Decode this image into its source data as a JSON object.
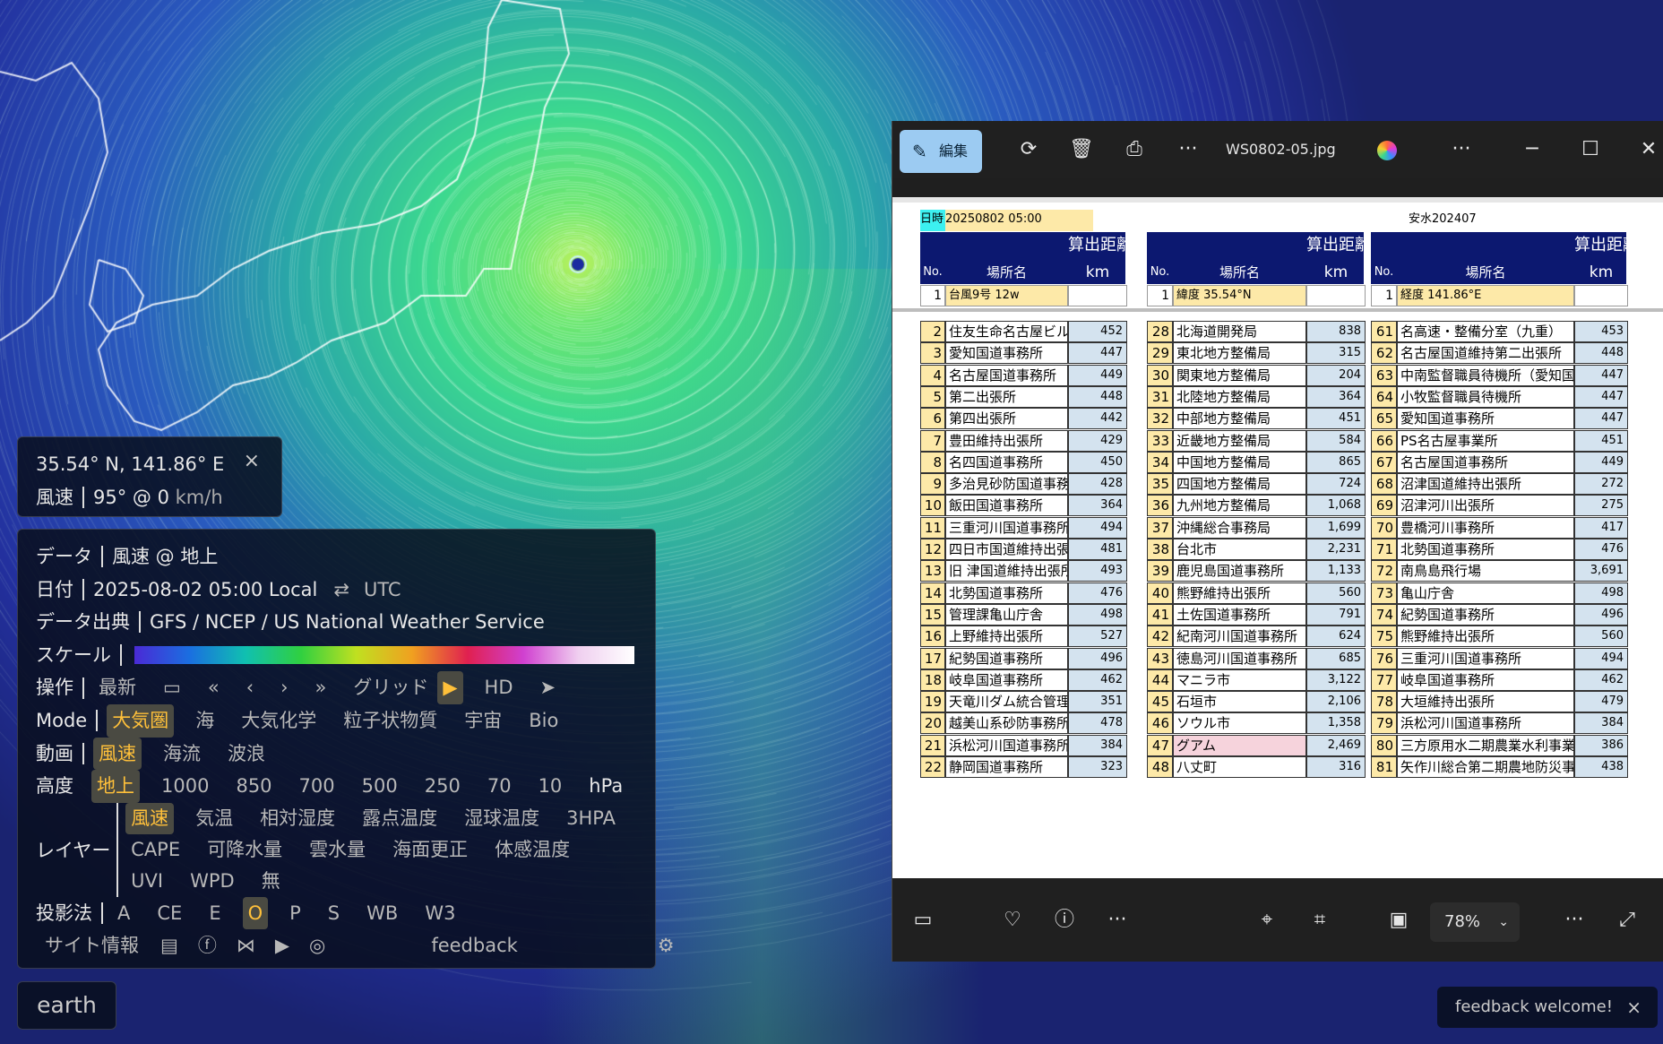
{
  "earth": {
    "coordinates": "35.54° N, 141.86° E",
    "close_icon": "×",
    "wind_label": "風速",
    "wind_value": "95° @ 0",
    "wind_unit": "km/h",
    "rows": {
      "data": {
        "label": "データ",
        "value": "風速 @ 地上"
      },
      "date": {
        "label": "日付",
        "value": "2025-08-02 05:00 Local",
        "swap": "⇄",
        "utc": "UTC"
      },
      "source": {
        "label": "データ出典",
        "value": "GFS / NCEP / US National Weather Service"
      },
      "scale": {
        "label": "スケール"
      },
      "control": {
        "label": "操作",
        "latest": "最新",
        "calendar_icon": "▭",
        "first": "«",
        "prev": "‹",
        "next": "›",
        "last": "»",
        "grid": "グリッド",
        "play": "▶",
        "hd": "HD",
        "locate": "➤"
      },
      "mode": {
        "label": "Mode",
        "options": [
          "大気圏",
          "海",
          "大気化学",
          "粒子状物質",
          "宇宙",
          "Bio"
        ]
      },
      "animation": {
        "label": "動画",
        "options": [
          "風速",
          "海流",
          "波浪"
        ]
      },
      "height": {
        "label": "高度",
        "options": [
          "地上",
          "1000",
          "850",
          "700",
          "500",
          "250",
          "70",
          "10"
        ],
        "unit": "hPa"
      },
      "layer": {
        "label": "レイヤー",
        "row1": [
          "風速",
          "気温",
          "相対湿度",
          "露点温度",
          "湿球温度",
          "3HPA"
        ],
        "row2": [
          "CAPE",
          "可降水量",
          "雲水量",
          "海面更正",
          "体感温度"
        ],
        "row3": [
          "UVI",
          "WPD",
          "無"
        ]
      },
      "projection": {
        "label": "投影法",
        "options": [
          "A",
          "CE",
          "E",
          "O",
          "P",
          "S",
          "WB",
          "W3"
        ]
      },
      "footer": {
        "about": "サイト情報",
        "feedback": "feedback"
      }
    },
    "earth_button": "earth",
    "feedback_welcome": "feedback welcome!",
    "feedback_close": "×"
  },
  "viewer": {
    "edit_label": "編集",
    "filename": "WS0802-05.jpg",
    "toolbar_icons": [
      "rotate-icon",
      "delete-icon",
      "print-icon",
      "more-icon"
    ],
    "more": "···",
    "minimize": "─",
    "maximize": "☐",
    "close": "✕",
    "zoom": "78%",
    "zoom_chevron": "⌄"
  },
  "sheet": {
    "date_label": "日時",
    "date_value": "20250802  05:00",
    "doc_code": "安水202407",
    "header_top": "算出距離",
    "header_no": "No.",
    "header_place": "場所名",
    "header_km": "km",
    "ref_rows": [
      {
        "no": "1",
        "name": "台風9号 12w"
      },
      {
        "no": "1",
        "name": "緯度 35.54°N"
      },
      {
        "no": "1",
        "name": "経度 141.86°E"
      }
    ],
    "col1": [
      [
        "2",
        "住友生命名古屋ビル",
        "452"
      ],
      [
        "3",
        "愛知国道事務所",
        "447"
      ],
      [
        "4",
        "名古屋国道事務所",
        "449"
      ],
      [
        "5",
        "第二出張所",
        "448"
      ],
      [
        "6",
        "第四出張所",
        "442"
      ],
      [
        "7",
        "豊田維持出張所",
        "429"
      ],
      [
        "8",
        "名四国道事務所",
        "450"
      ],
      [
        "9",
        "多治見砂防国道事務所",
        "428"
      ],
      [
        "10",
        "飯田国道事務所",
        "364"
      ],
      [
        "11",
        "三重河川国道事務所",
        "494"
      ],
      [
        "12",
        "四日市国道維持出張所",
        "481"
      ],
      [
        "13",
        "旧 津国道維持出張所",
        "493"
      ],
      [
        "14",
        "北勢国道事務所",
        "476"
      ],
      [
        "15",
        "管理課亀山庁舎",
        "498"
      ],
      [
        "16",
        "上野維持出張所",
        "527"
      ],
      [
        "17",
        "紀勢国道事務所",
        "496"
      ],
      [
        "18",
        "岐阜国道事務所",
        "462"
      ],
      [
        "19",
        "天竜川ダム統合管理",
        "351"
      ],
      [
        "20",
        "越美山系砂防事務所",
        "478"
      ],
      [
        "21",
        "浜松河川国道事務所",
        "384"
      ],
      [
        "22",
        "静岡国道事務所",
        "323"
      ]
    ],
    "col2": [
      [
        "28",
        "北海道開発局",
        "838"
      ],
      [
        "29",
        "東北地方整備局",
        "315"
      ],
      [
        "30",
        "関東地方整備局",
        "204"
      ],
      [
        "31",
        "北陸地方整備局",
        "364"
      ],
      [
        "32",
        "中部地方整備局",
        "451"
      ],
      [
        "33",
        "近畿地方整備局",
        "584"
      ],
      [
        "34",
        "中国地方整備局",
        "865"
      ],
      [
        "35",
        "四国地方整備局",
        "724"
      ],
      [
        "36",
        "九州地方整備局",
        "1,068"
      ],
      [
        "37",
        "沖縄総合事務局",
        "1,699"
      ],
      [
        "38",
        "台北市",
        "2,231"
      ],
      [
        "39",
        "鹿児島国道事務所",
        "1,133"
      ],
      [
        "40",
        "熊野維持出張所",
        "560"
      ],
      [
        "41",
        "土佐国道事務所",
        "791"
      ],
      [
        "42",
        "紀南河川国道事務所",
        "624"
      ],
      [
        "43",
        "徳島河川国道事務所",
        "685"
      ],
      [
        "44",
        "マニラ市",
        "3,122"
      ],
      [
        "45",
        "石垣市",
        "2,106"
      ],
      [
        "46",
        "ソウル市",
        "1,358"
      ],
      [
        "47",
        "グアム",
        "2,469"
      ],
      [
        "48",
        "八丈町",
        "316"
      ]
    ],
    "col3": [
      [
        "61",
        "名高速・整備分室（九重）",
        "453"
      ],
      [
        "62",
        "名古屋国道維持第二出張所",
        "448"
      ],
      [
        "63",
        "中南監督職員待機所（愛知国",
        "447"
      ],
      [
        "64",
        "小牧監督職員待機所",
        "447"
      ],
      [
        "65",
        "愛知国道事務所",
        "447"
      ],
      [
        "66",
        "PS名古屋事業所",
        "451"
      ],
      [
        "67",
        "名古屋国道事務所",
        "449"
      ],
      [
        "68",
        "沼津国道維持出張所",
        "272"
      ],
      [
        "69",
        "沼津河川出張所",
        "275"
      ],
      [
        "70",
        "豊橋河川事務所",
        "417"
      ],
      [
        "71",
        "北勢国道事務所",
        "476"
      ],
      [
        "72",
        "南鳥島飛行場",
        "3,691"
      ],
      [
        "73",
        "亀山庁舎",
        "498"
      ],
      [
        "74",
        "紀勢国道事務所",
        "496"
      ],
      [
        "75",
        "熊野維持出張所",
        "560"
      ],
      [
        "76",
        "三重河川国道事務所",
        "494"
      ],
      [
        "77",
        "岐阜国道事務所",
        "462"
      ],
      [
        "78",
        "大垣維持出張所",
        "479"
      ],
      [
        "79",
        "浜松河川国道事務所",
        "384"
      ],
      [
        "80",
        "三方原用水二期農業水利事業",
        "386"
      ],
      [
        "81",
        "矢作川総合第二期農地防災事",
        "438"
      ]
    ]
  },
  "colors": {
    "panel_bg": "#080e1c",
    "selected": "#ffc03a",
    "edit_button": "#9ccbf2",
    "sheet_header": "#0c1870",
    "cell_yellow": "#fde9a8",
    "cell_blue": "#d4e3ef",
    "cell_pink": "#f6d3dc"
  }
}
